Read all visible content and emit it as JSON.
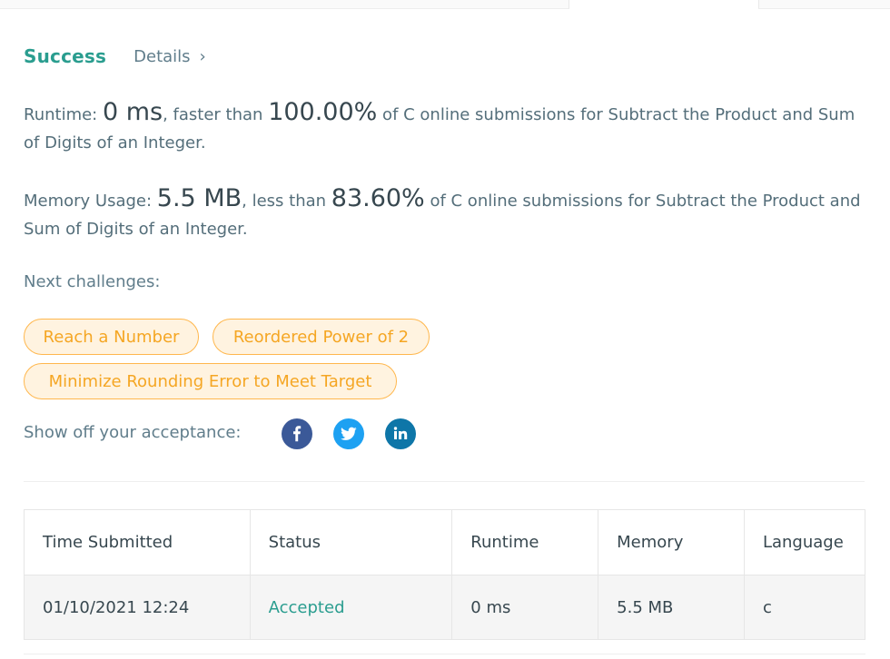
{
  "header": {
    "status": "Success",
    "details_label": "Details",
    "details_chevron": "›"
  },
  "runtime": {
    "label": "Runtime: ",
    "value": "0 ms",
    "comparison": ", faster than ",
    "percent": "100.00%",
    "suffix": " of C online submissions for Subtract the Product and Sum of Digits of an Integer."
  },
  "memory": {
    "label": "Memory Usage: ",
    "value": "5.5 MB",
    "comparison": ", less than ",
    "percent": "83.60%",
    "suffix": " of C online submissions for Subtract the Product and Sum of Digits of an Integer."
  },
  "next": {
    "label": "Next challenges:",
    "challenges": [
      "Reach a Number",
      "Reordered Power of 2",
      "Minimize Rounding Error to Meet Target"
    ]
  },
  "share": {
    "label": "Show off your acceptance:",
    "icons": [
      "facebook-icon",
      "twitter-icon",
      "linkedin-icon"
    ],
    "colors": {
      "facebook": "#3b5998",
      "twitter": "#1da1f2",
      "linkedin": "#0e76a8"
    }
  },
  "table": {
    "headers": [
      "Time Submitted",
      "Status",
      "Runtime",
      "Memory",
      "Language"
    ],
    "rows": [
      [
        "01/10/2021 12:24",
        "Accepted",
        "0 ms",
        "5.5 MB",
        "c"
      ]
    ]
  },
  "colors": {
    "success": "#2a9d8f",
    "chip_text": "#f5a623",
    "chip_border": "#ffb74d",
    "chip_bg": "#fff3e0"
  }
}
